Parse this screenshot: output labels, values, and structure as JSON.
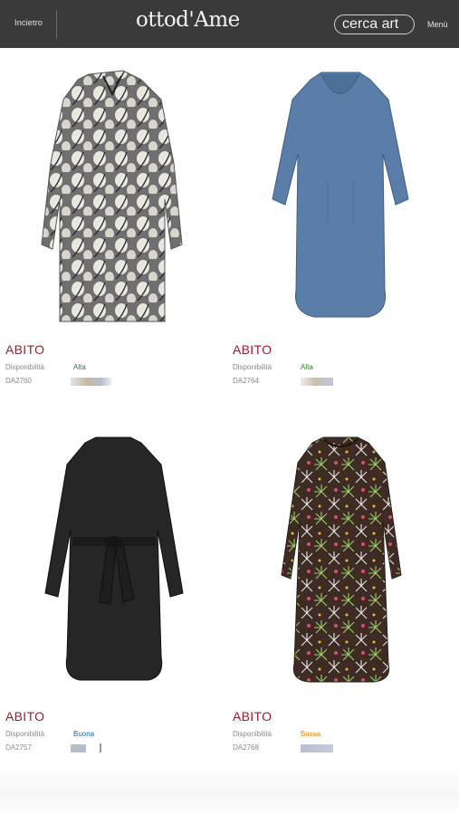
{
  "header": {
    "back_label": "Incietro",
    "logo_text": "ottod'Ame",
    "search_text": "cerca art",
    "menu_label": "Menù"
  },
  "products": [
    {
      "title": "ABITO",
      "availability_label": "Disponibilità",
      "availability": "Alta",
      "availability_color": "#2e7d32",
      "code": "DA2760",
      "image_icon": "patterned-shirt-dress"
    },
    {
      "title": "ABITO",
      "availability_label": "Disponibilità",
      "availability": "Alta",
      "availability_color": "#2e7d32",
      "code": "DA2764",
      "image_icon": "blue-dress"
    },
    {
      "title": "ABITO",
      "availability_label": "Disponibilità",
      "availability": "Buona",
      "availability_color": "#1565c0",
      "code": "DA2757",
      "image_icon": "black-belted-dress"
    },
    {
      "title": "ABITO",
      "availability_label": "Disponibilità",
      "availability": "Bassa",
      "availability_color": "#ef8a00",
      "code": "DA2768",
      "image_icon": "firework-print-dress"
    }
  ]
}
